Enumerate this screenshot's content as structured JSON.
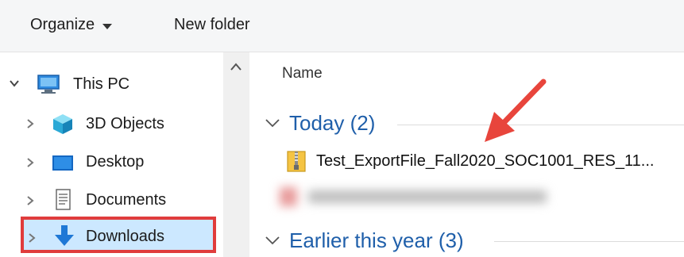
{
  "toolbar": {
    "organize_label": "Organize",
    "new_folder_label": "New folder"
  },
  "nav": {
    "items": [
      {
        "label": "This PC",
        "icon": "monitor-icon",
        "expanded": true
      },
      {
        "label": "3D Objects",
        "icon": "cube-icon"
      },
      {
        "label": "Desktop",
        "icon": "desktop-icon"
      },
      {
        "label": "Documents",
        "icon": "document-icon"
      },
      {
        "label": "Downloads",
        "icon": "download-arrow-icon",
        "selected": true
      }
    ]
  },
  "content": {
    "column_name": "Name",
    "groups": [
      {
        "label": "Today (2)"
      },
      {
        "label": "Earlier this year (3)"
      }
    ],
    "files": [
      {
        "name": "Test_ExportFile_Fall2020_SOC1001_RES_11...",
        "icon": "zip-folder-icon"
      }
    ]
  },
  "colors": {
    "accent": "#1f5faa",
    "selection": "#cce8ff",
    "highlight_border": "#e03c3c",
    "arrow": "#e8453c"
  }
}
